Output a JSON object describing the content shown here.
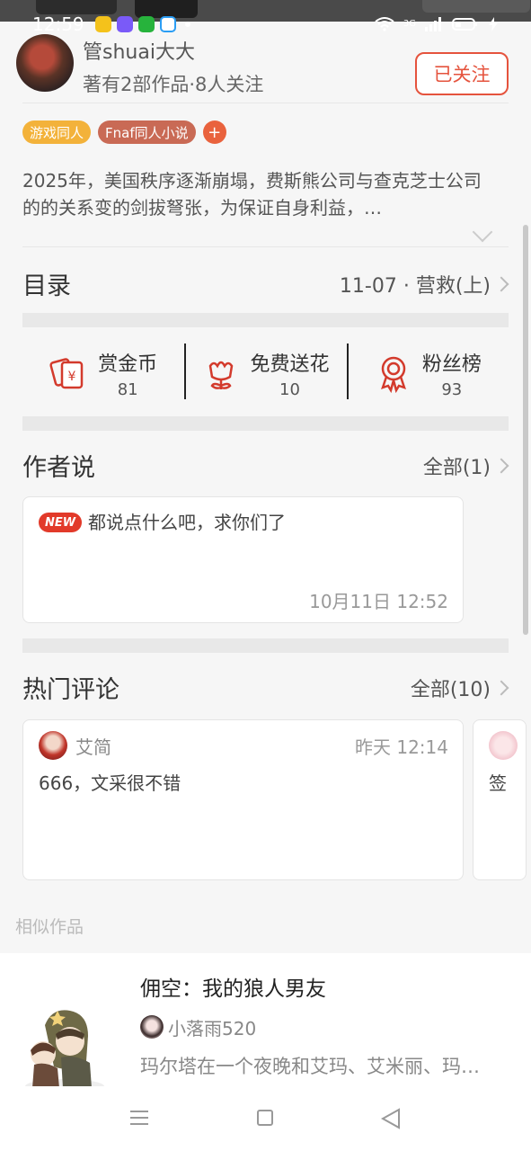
{
  "status_bar": {
    "time": "12:59",
    "network": "3G",
    "apps": [
      "yellow-app-icon",
      "blue-app-icon",
      "iqiyi-icon",
      "blue-swirl-icon"
    ]
  },
  "author": {
    "name": "管shuai大大",
    "meta": "著有2部作品·8人关注",
    "follow_label": "已关注"
  },
  "tags": [
    {
      "label": "游戏同人"
    },
    {
      "label": "Fnaf同人小说"
    },
    {
      "label": "+"
    }
  ],
  "synopsis": "2025年，美国秩序逐渐崩塌，费斯熊公司与查克芝士公司的的关系变的剑拔弩张，为保证自身利益，…",
  "catalog": {
    "title": "目录",
    "latest": "11-07 · 营救(上)"
  },
  "stats": [
    {
      "label": "赏金币",
      "value": "81",
      "icon": "reward-coin-icon"
    },
    {
      "label": "免费送花",
      "value": "10",
      "icon": "flower-icon"
    },
    {
      "label": "粉丝榜",
      "value": "93",
      "icon": "medal-icon"
    }
  ],
  "author_says": {
    "title": "作者说",
    "all_label": "全部(1)",
    "badge": "NEW",
    "text": "都说点什么吧，求你们了",
    "time": "10月11日  12:52"
  },
  "hot_comments": {
    "title": "热门评论",
    "all_label": "全部(10)",
    "items": [
      {
        "name": "艾简",
        "time": "昨天 12:14",
        "text": "666，文采很不错"
      },
      {
        "name": "",
        "time": "",
        "text": "签"
      }
    ]
  },
  "similar": {
    "title": "相似作品",
    "book": {
      "title": "佣空：我的狼人男友",
      "author": "小落雨520",
      "desc": "玛尔塔在一个夜晚和艾玛、艾米丽、玛…"
    }
  },
  "colors": {
    "accent": "#e5533d",
    "tag_game": "#f3b23a",
    "tag_fnaf": "#c96a55"
  }
}
